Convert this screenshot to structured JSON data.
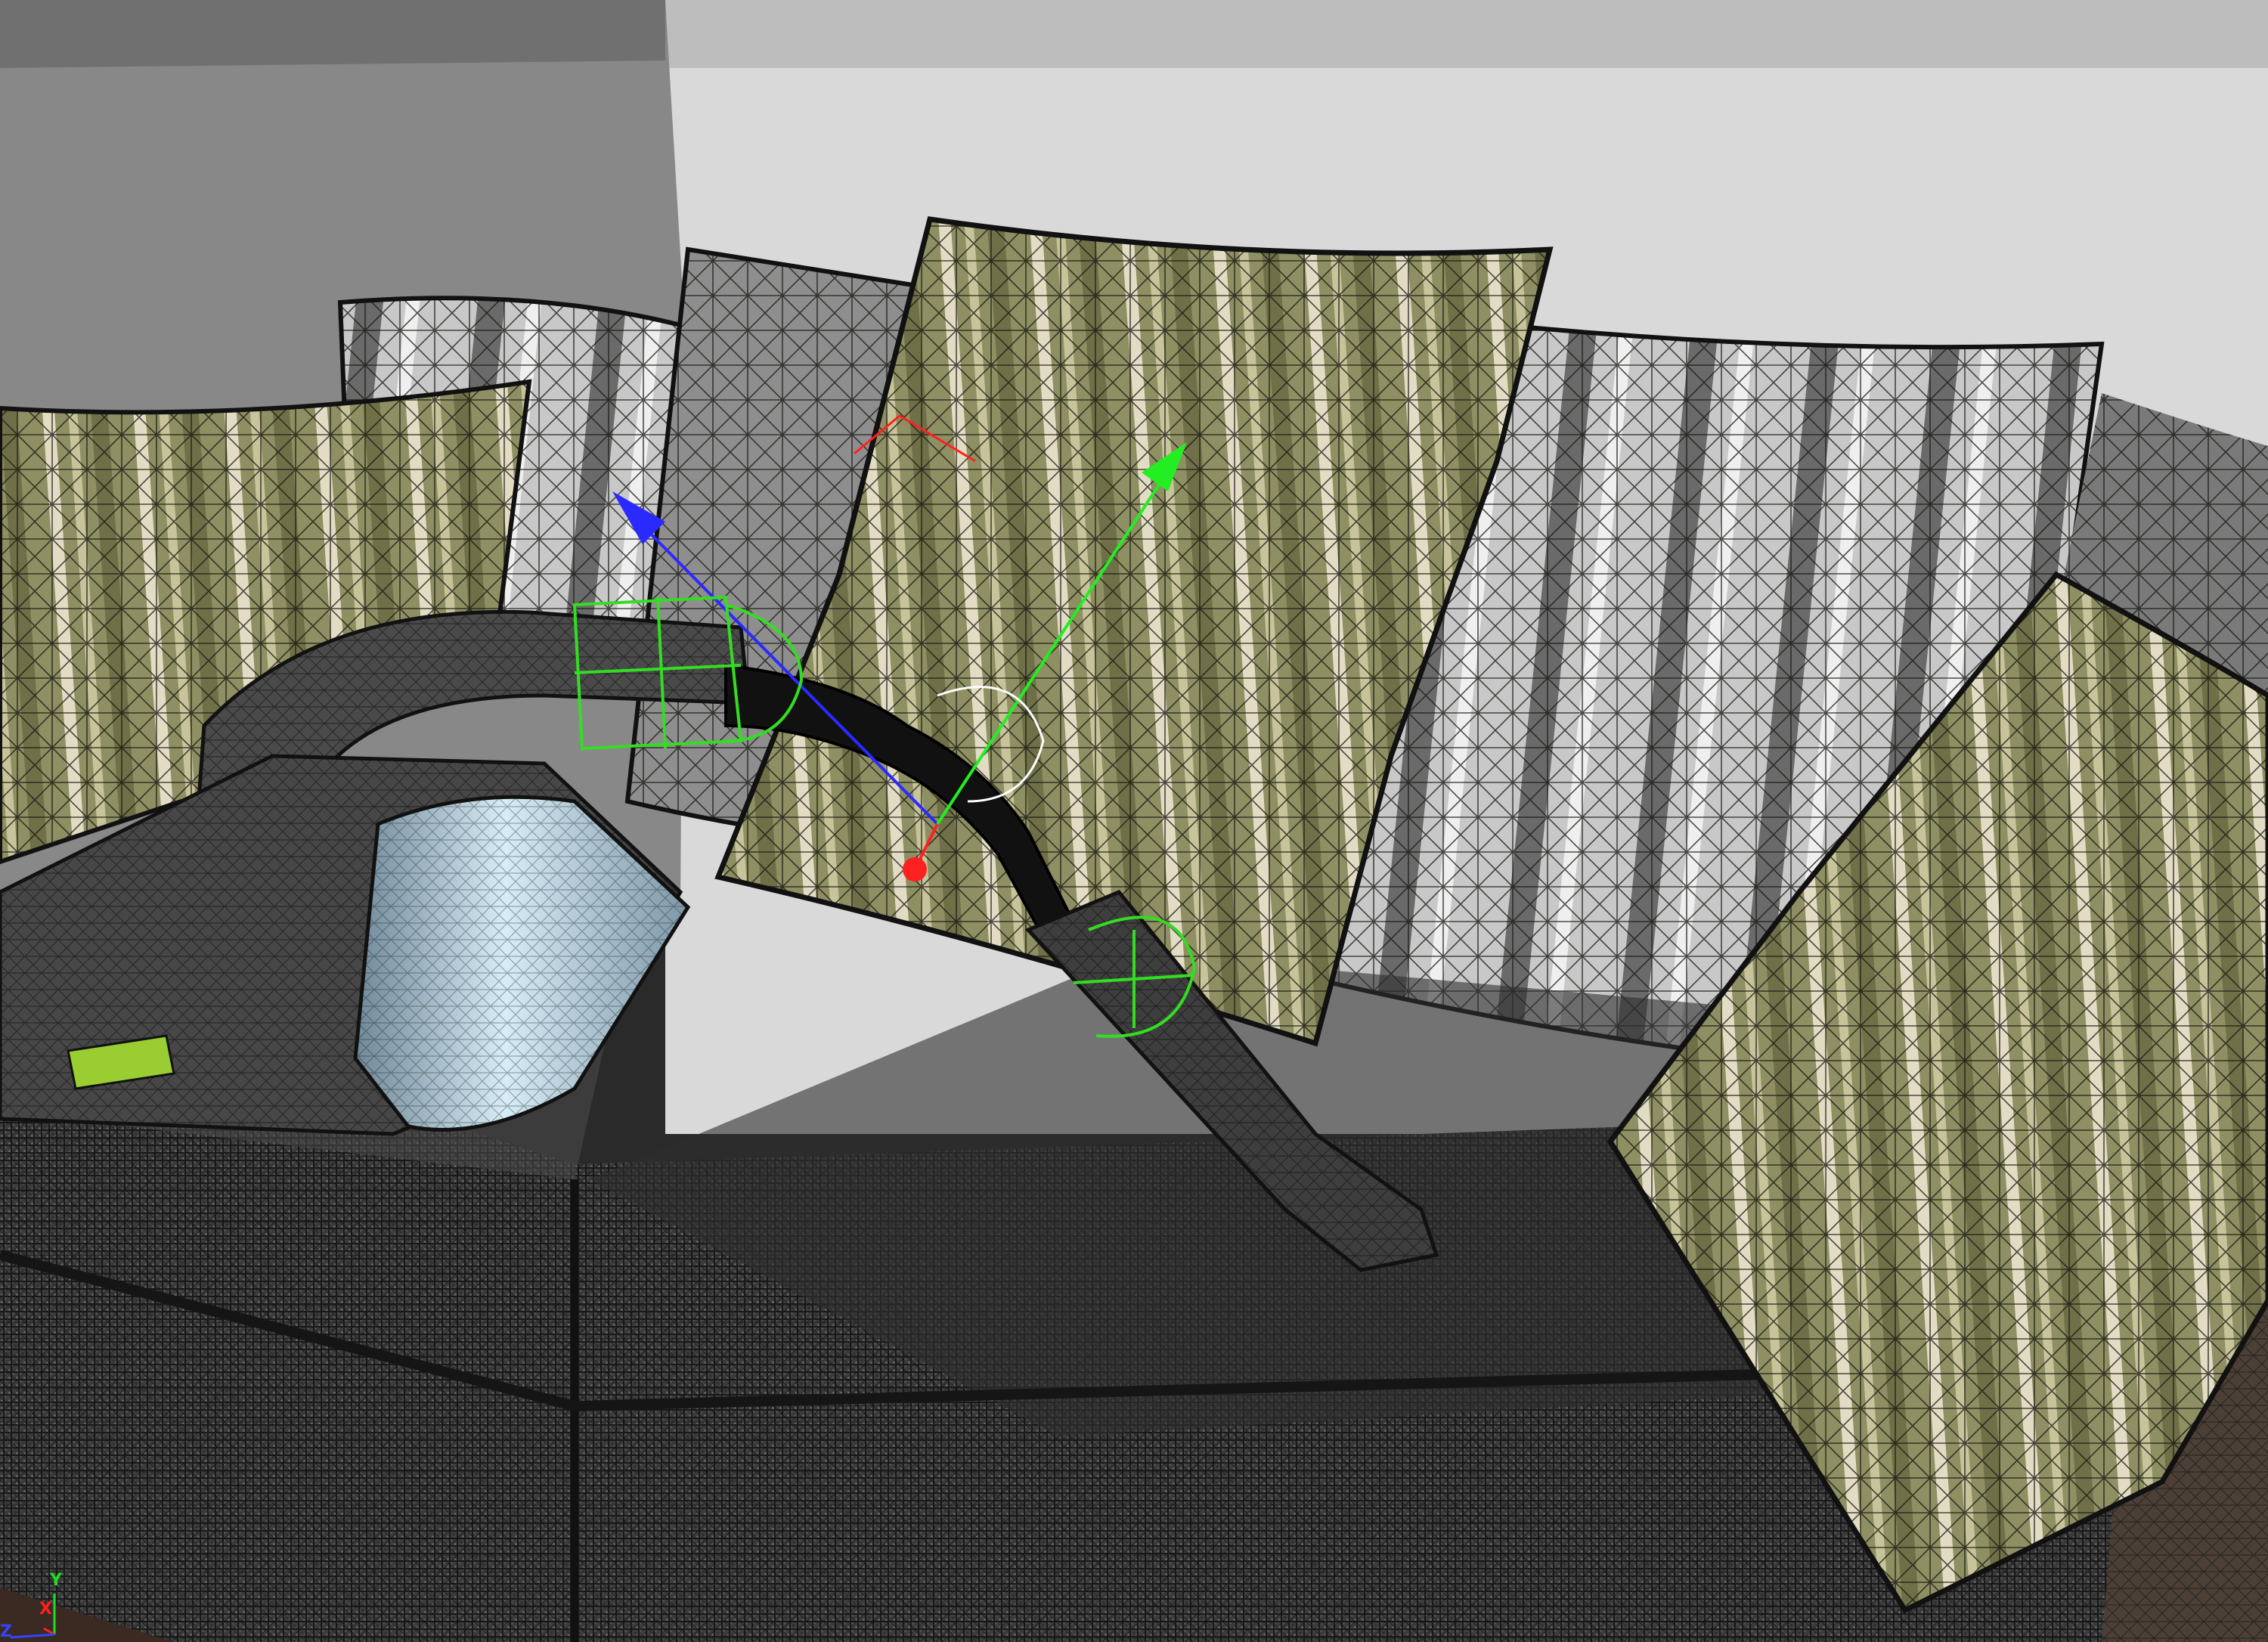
{
  "viewport": {
    "axis_indicator": {
      "y_label": "Y",
      "x_label": "X",
      "z_label": "Z",
      "y_color": "#22dd22",
      "x_color": "#ff2020",
      "z_color": "#3344ff"
    },
    "gizmo": {
      "x_color": "#ff2020",
      "y_color": "#22ee22",
      "z_color": "#2a2aff",
      "selection_color": "#33dd22"
    },
    "colors": {
      "wall_left": "#8a8a8a",
      "wall_back": "#d8d8d8",
      "ceiling": "#bdbdbd",
      "sofa_fabric": "#3a3a3a",
      "pillow_green": "#9a9a6a",
      "pillow_gray": "#b8b8b8",
      "vacuum_body": "#4a4a4a",
      "vacuum_bin": "#a9c4d4",
      "vacuum_accent": "#9acd32",
      "floor": "#3a2a22"
    }
  }
}
